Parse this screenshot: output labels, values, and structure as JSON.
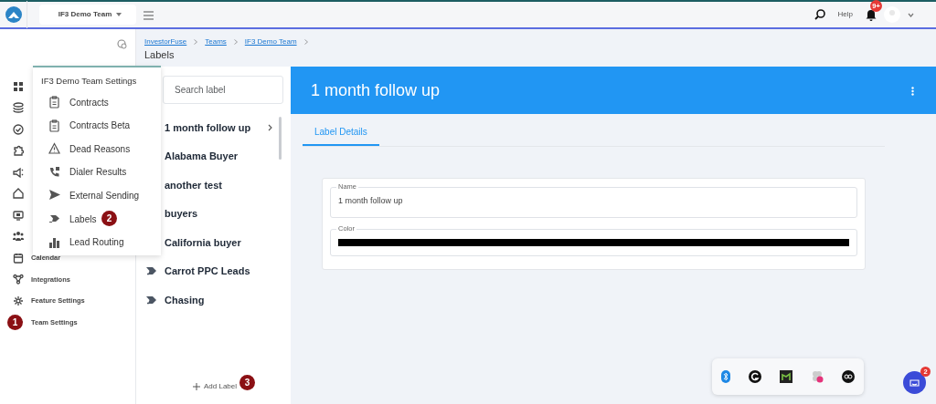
{
  "topbar": {
    "team_select": "IF3 Demo Team",
    "help": "Help",
    "notification_badge": "9+"
  },
  "sidebar": {
    "items": [
      {
        "label": "Calendar"
      },
      {
        "label": "Integrations"
      },
      {
        "label": "Feature Settings"
      },
      {
        "label": "Team Settings",
        "callout": "1"
      }
    ]
  },
  "breadcrumb": [
    "InvestorFuse",
    "Teams",
    "IF3 Demo Team"
  ],
  "page_title": "Labels",
  "settings_menu": {
    "title": "IF3 Demo Team Settings",
    "items": [
      {
        "label": "Contracts"
      },
      {
        "label": "Contracts Beta"
      },
      {
        "label": "Dead Reasons"
      },
      {
        "label": "Dialer Results"
      },
      {
        "label": "External Sending"
      },
      {
        "label": "Labels",
        "callout": "2"
      },
      {
        "label": "Lead Routing"
      }
    ]
  },
  "label_list": {
    "search": {
      "placeholder": "Search label"
    },
    "items": [
      {
        "label": "1 month follow up",
        "selected": true
      },
      {
        "label": "Alabama Buyer",
        "selected": false
      },
      {
        "label": "another test",
        "selected": false
      },
      {
        "label": "buyers",
        "selected": false
      },
      {
        "label": "California buyer",
        "selected": false
      },
      {
        "label": "Carrot PPC Leads",
        "selected": false
      },
      {
        "label": "Chasing",
        "selected": false
      }
    ],
    "add_button": {
      "label": "Add Label",
      "callout": "3"
    }
  },
  "detail": {
    "title": "1 month follow up",
    "tabs": [
      {
        "label": "Label Details",
        "selected": true
      }
    ],
    "fields": [
      {
        "kind": "text",
        "label": "Name",
        "value": "1 month follow up"
      },
      {
        "kind": "color",
        "label": "Color",
        "color": "#000000"
      }
    ]
  },
  "chat_badge": "2"
}
